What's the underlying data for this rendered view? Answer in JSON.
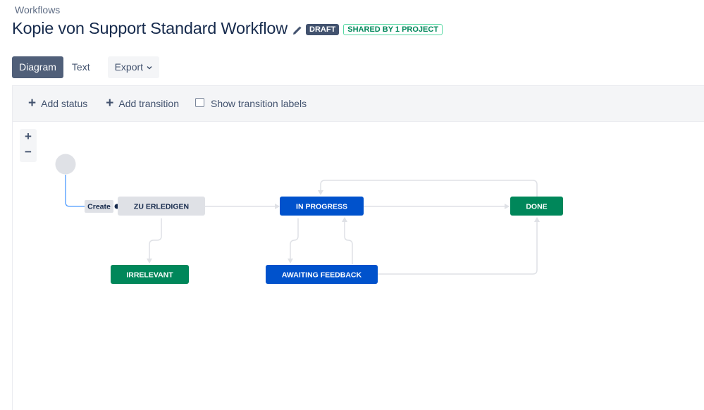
{
  "header": {
    "breadcrumb": "Workflows",
    "title": "Kopie von Support Standard Workflow",
    "badge_draft": "DRAFT",
    "badge_shared": "SHARED BY 1 PROJECT"
  },
  "tabs": {
    "diagram": "Diagram",
    "text": "Text",
    "export": "Export"
  },
  "toolbar": {
    "add_status": "Add status",
    "add_transition": "Add transition",
    "show_transition_labels": "Show transition labels",
    "show_transition_labels_checked": false
  },
  "zoom": {
    "in": "+",
    "out": "−"
  },
  "diagram": {
    "create_label": "Create",
    "statuses": {
      "zu_erledigen": "ZU ERLEDIGEN",
      "in_progress": "IN PROGRESS",
      "done": "DONE",
      "irrelevant": "IRRELEVANT",
      "awaiting_feedback": "AWAITING FEEDBACK"
    }
  },
  "colors": {
    "todo_bg": "#dfe1e6",
    "in_progress_bg": "#0052cc",
    "done_bg": "#00875a",
    "draft_badge": "#42526e",
    "active_tab": "#505f79"
  }
}
